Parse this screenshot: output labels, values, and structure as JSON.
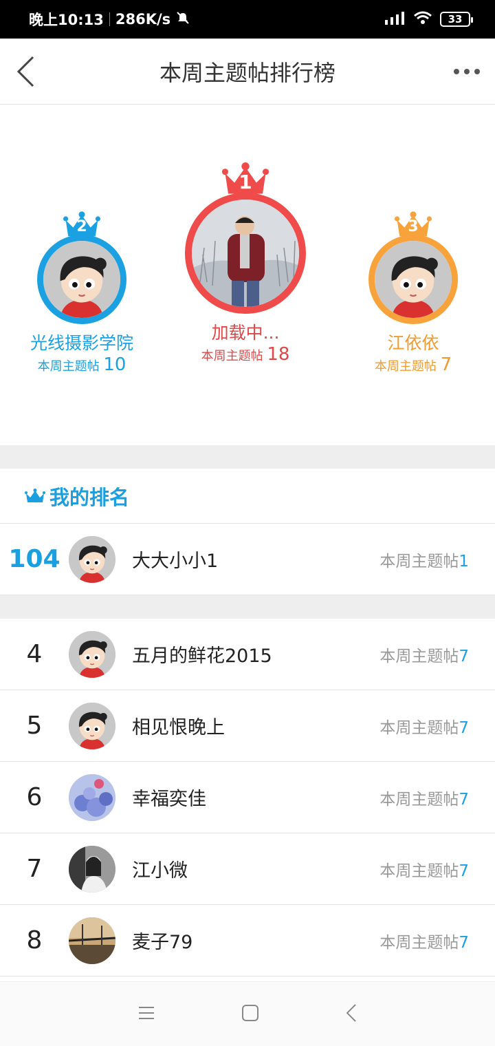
{
  "status_bar": {
    "time": "晚上10:13",
    "speed": "286K/s",
    "battery": "33"
  },
  "nav": {
    "title": "本周主题帖排行榜"
  },
  "podium": [
    {
      "rank": "2",
      "name": "光线摄影学院",
      "count_label": "本周主题帖",
      "count": "10",
      "color": "#1ba1e2"
    },
    {
      "rank": "1",
      "name": "加载中...",
      "count_label": "本周主题帖",
      "count": "18",
      "color": "#f04b4b"
    },
    {
      "rank": "3",
      "name": "江依依",
      "count_label": "本周主题帖",
      "count": "7",
      "color": "#f7a23a"
    }
  ],
  "my_rank": {
    "header": "我的排名",
    "rank": "104",
    "name": "大大小小1",
    "count_label": "本周主题帖",
    "count": "1"
  },
  "list": [
    {
      "rank": "4",
      "name": "五月的鲜花2015",
      "count_label": "本周主题帖",
      "count": "7"
    },
    {
      "rank": "5",
      "name": "相见恨晚上",
      "count_label": "本周主题帖",
      "count": "7"
    },
    {
      "rank": "6",
      "name": "幸福奕佳",
      "count_label": "本周主题帖",
      "count": "7"
    },
    {
      "rank": "7",
      "name": "江小微",
      "count_label": "本周主题帖",
      "count": "7"
    },
    {
      "rank": "8",
      "name": "麦子79",
      "count_label": "本周主题帖",
      "count": "7"
    }
  ]
}
